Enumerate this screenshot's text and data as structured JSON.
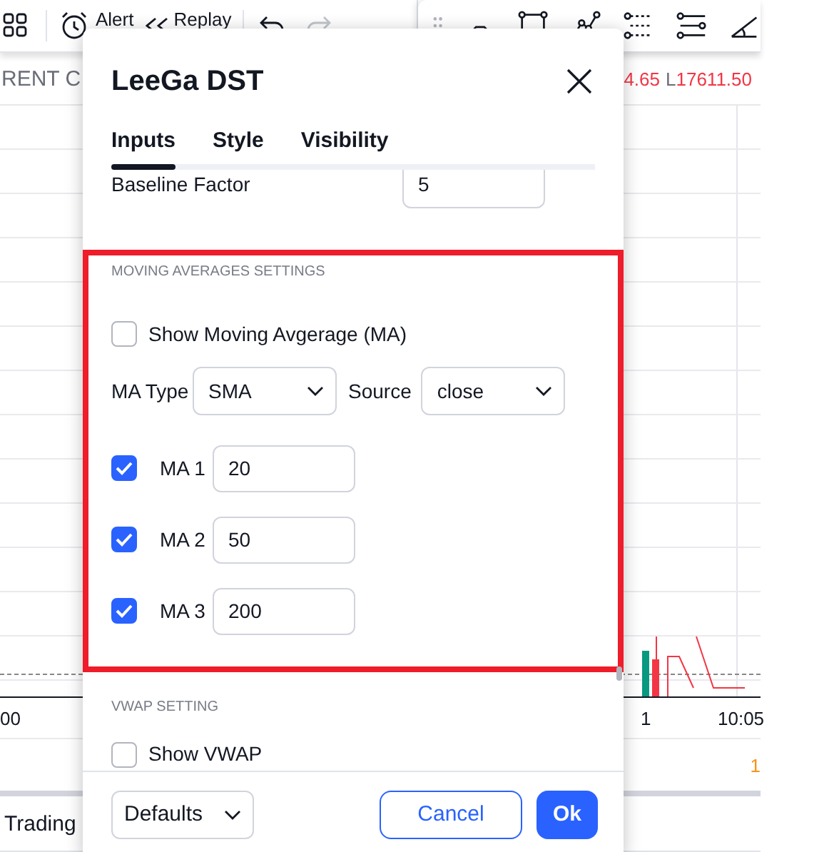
{
  "toolbar": {
    "alert": "Alert",
    "replay": "Replay"
  },
  "legend": {
    "title": "RENT C",
    "high_tail": "4.65",
    "low_label": "L",
    "low_value": "17611.50"
  },
  "time_axis": [
    "00",
    "1",
    "10:05"
  ],
  "price_tail": "1",
  "bottom_panel": {
    "title": "Trading"
  },
  "dialog": {
    "title": "LeeGa DST",
    "tabs": [
      {
        "label": "Inputs",
        "selected": true
      },
      {
        "label": "Style",
        "selected": false
      },
      {
        "label": "Visibility",
        "selected": false
      }
    ],
    "baseline": {
      "label": "Baseline Factor",
      "value": "5"
    },
    "ma_section": {
      "heading": "MOVING AVERAGES SETTINGS",
      "highlighted": true,
      "show_ma": {
        "label": "Show Moving Avgerage (MA)",
        "checked": false
      },
      "ma_type": {
        "label": "MA Type",
        "value": "SMA"
      },
      "source": {
        "label": "Source",
        "value": "close"
      },
      "lines": [
        {
          "label": "MA 1",
          "value": "20",
          "checked": true
        },
        {
          "label": "MA 2",
          "value": "50",
          "checked": true
        },
        {
          "label": "MA 3",
          "value": "200",
          "checked": true
        }
      ]
    },
    "vwap_section": {
      "heading": "VWAP SETTING",
      "show_vwap": {
        "label": "Show VWAP",
        "checked": false
      }
    },
    "footer": {
      "defaults": "Defaults",
      "cancel": "Cancel",
      "ok": "Ok"
    }
  }
}
